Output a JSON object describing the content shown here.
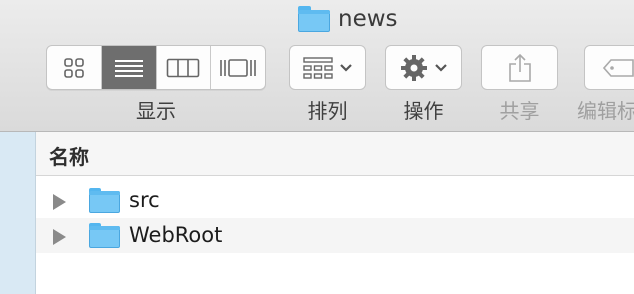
{
  "window": {
    "title": "news"
  },
  "toolbar": {
    "view_label": "显示",
    "arrange_label": "排列",
    "action_label": "操作",
    "share_label": "共享",
    "tags_label": "编辑标"
  },
  "list": {
    "column_name": "名称",
    "rows": [
      {
        "name": "src"
      },
      {
        "name": "WebRoot"
      }
    ]
  }
}
